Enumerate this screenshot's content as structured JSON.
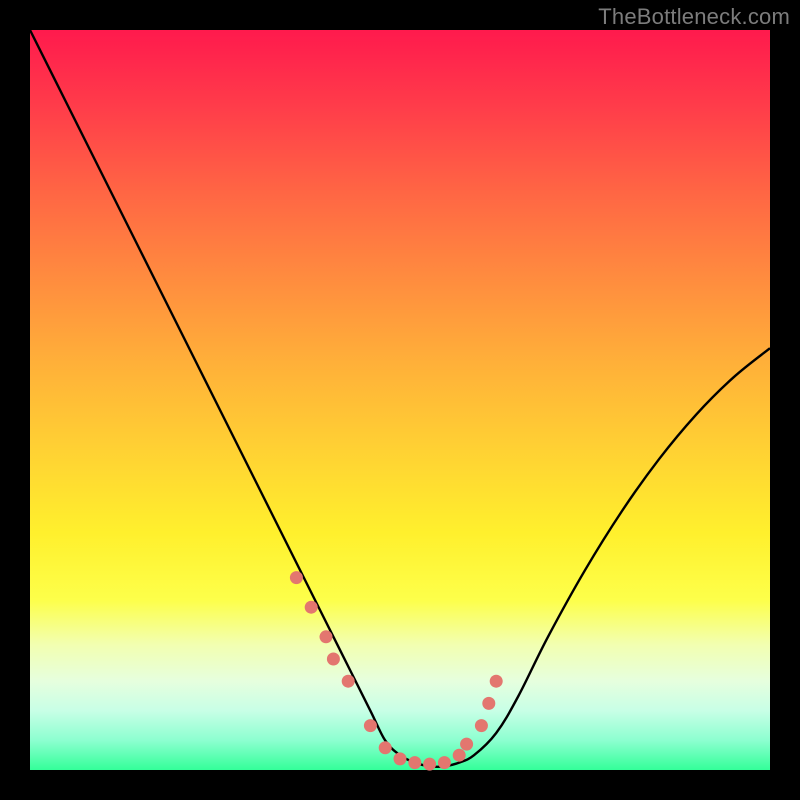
{
  "watermark": "TheBottleneck.com",
  "colors": {
    "frame": "#000000",
    "curve": "#000000",
    "dots": "#e3766f",
    "gradient_top": "#ff1a4d",
    "gradient_bottom": "#33ff99"
  },
  "chart_data": {
    "type": "line",
    "title": "",
    "xlabel": "",
    "ylabel": "",
    "xlim": [
      0,
      100
    ],
    "ylim": [
      0,
      100
    ],
    "grid": false,
    "legend": false,
    "note": "V-shaped bottleneck curve; axes unlabeled in image, values estimated from plot geometry (0–100 normalized).",
    "series": [
      {
        "name": "bottleneck-curve",
        "x": [
          0,
          5,
          10,
          15,
          20,
          25,
          30,
          35,
          40,
          43,
          46,
          48,
          50,
          52,
          54,
          56,
          58,
          60,
          63,
          66,
          70,
          75,
          80,
          85,
          90,
          95,
          100
        ],
        "y": [
          100,
          90,
          80,
          70,
          60,
          50,
          40,
          30,
          20,
          14,
          8,
          4,
          2,
          1,
          0.5,
          0.5,
          1,
          2,
          5,
          10,
          18,
          27,
          35,
          42,
          48,
          53,
          57
        ]
      }
    ],
    "dots": {
      "name": "highlighted-points",
      "x": [
        36,
        38,
        40,
        41,
        43,
        46,
        48,
        50,
        52,
        54,
        56,
        58,
        59,
        61,
        62,
        63
      ],
      "y": [
        26,
        22,
        18,
        15,
        12,
        6,
        3,
        1.5,
        1,
        0.8,
        1,
        2,
        3.5,
        6,
        9,
        12
      ]
    }
  }
}
